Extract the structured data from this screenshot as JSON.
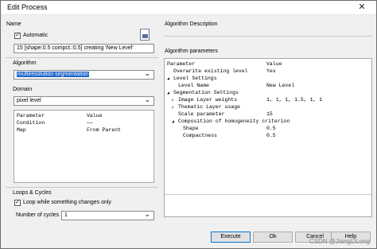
{
  "window": {
    "title": "Edit Process",
    "close_symbol": "✕"
  },
  "left": {
    "name_label": "Name",
    "automatic_label": "Automatic",
    "automatic_checked": true,
    "name_value": "15 [shape:0.5 compct.:0.5] creating 'New Level'",
    "algorithm_label": "Algorithm",
    "algorithm_value": "multiresolution segmentation",
    "domain_label": "Domain",
    "domain_value": "pixel level",
    "domain_table": {
      "headers": [
        "Parameter",
        "Value"
      ],
      "rows": [
        {
          "param": "Condition",
          "value": "——"
        },
        {
          "param": "Map",
          "value": "From Parent"
        }
      ]
    },
    "loops_label": "Loops & Cycles",
    "loop_label": "Loop while something changes only",
    "loop_checked": true,
    "cycles_label": "Number of cycles",
    "cycles_value": "1"
  },
  "right": {
    "description_label": "Algorithm Description",
    "params_label": "Algorithm parameters",
    "params_headers": [
      "Parameter",
      "Value"
    ],
    "params": [
      {
        "indent": 0,
        "marker": "",
        "name": "Overwrite existing level",
        "value": "Yes"
      },
      {
        "indent": 0,
        "marker": "◢",
        "name": "Level Settings",
        "value": ""
      },
      {
        "indent": 1,
        "marker": "",
        "name": "Level Name",
        "value": "New Level"
      },
      {
        "indent": 0,
        "marker": "◢",
        "name": "Segmentation Settings",
        "value": ""
      },
      {
        "indent": 1,
        "marker": "▷",
        "name": "Image Layer weights",
        "value": "1, 1, 1, 1.5, 1, 1"
      },
      {
        "indent": 1,
        "marker": "▷",
        "name": "Thematic Layer usage",
        "value": ""
      },
      {
        "indent": 1,
        "marker": "",
        "name": "Scale parameter",
        "value": "15"
      },
      {
        "indent": 1,
        "marker": "◢",
        "name": "Composition of homogeneity criterion",
        "value": ""
      },
      {
        "indent": 2,
        "marker": "",
        "name": "Shape",
        "value": "0.5"
      },
      {
        "indent": 2,
        "marker": "",
        "name": "Compactness",
        "value": "0.5"
      }
    ]
  },
  "buttons": {
    "execute": "Execute",
    "ok": "Ok",
    "cancel": "Cancel",
    "help": "Help"
  },
  "watermark": "CSDN @JiangLiLong"
}
